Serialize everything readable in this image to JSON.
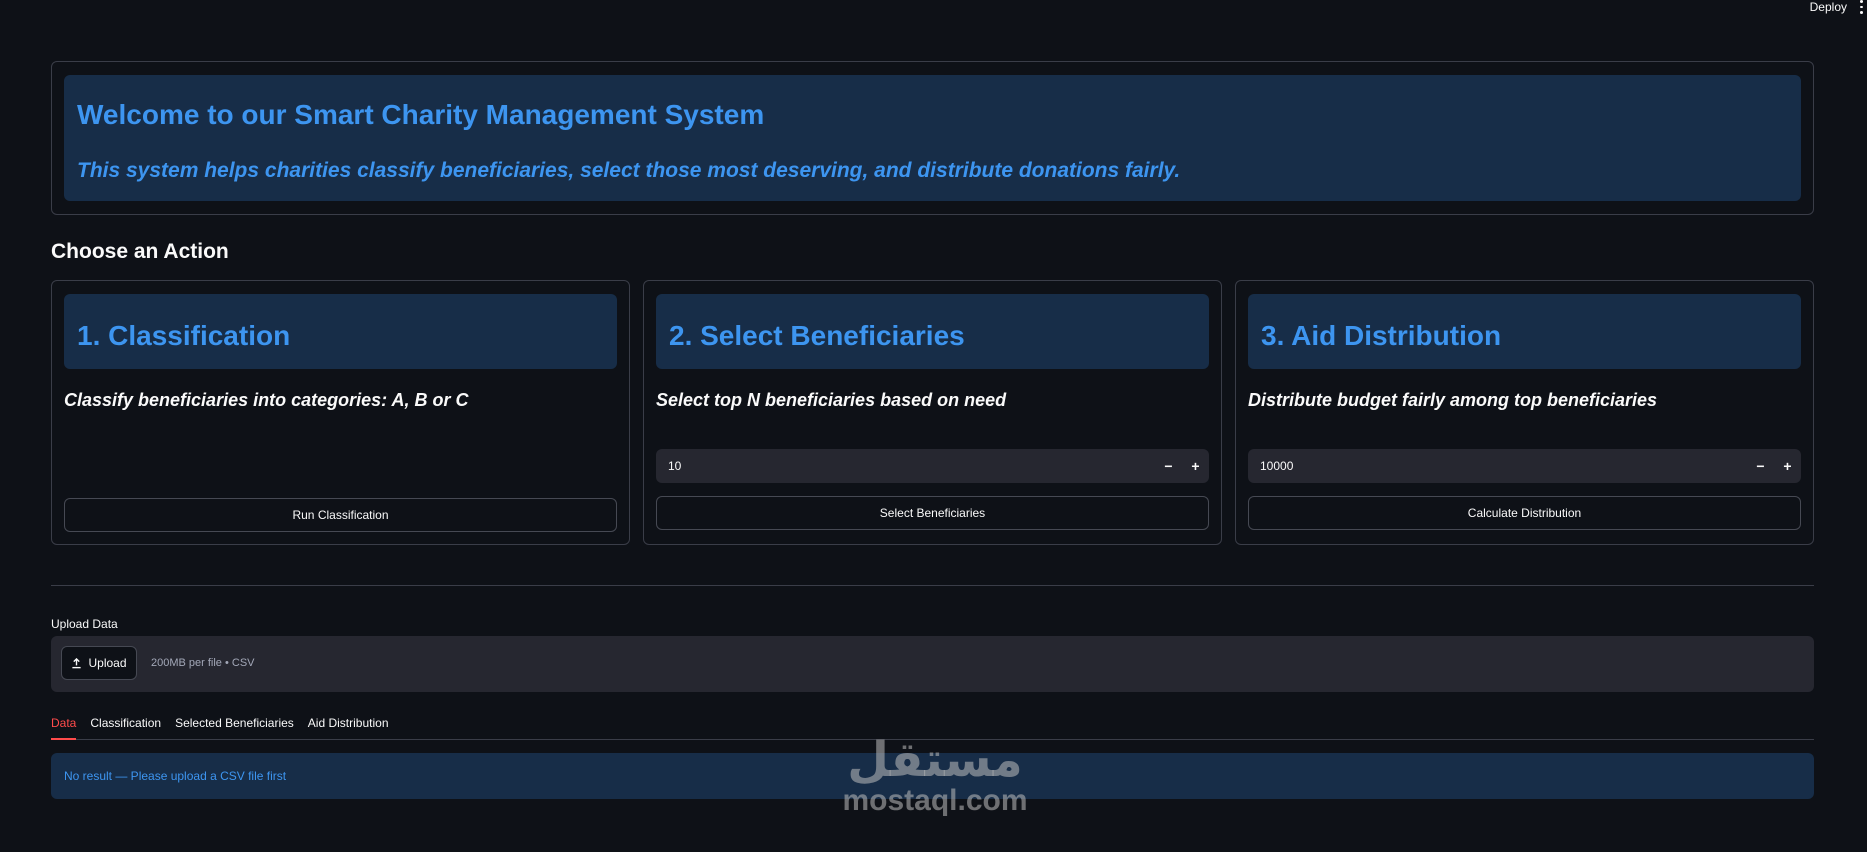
{
  "topbar": {
    "deploy_label": "Deploy"
  },
  "welcome": {
    "title": "Welcome to our Smart Charity Management System",
    "subtitle": "This system helps charities classify beneficiaries, select those most deserving, and distribute donations fairly."
  },
  "actions": {
    "section_title": "Choose an Action",
    "classification": {
      "title": "1. Classification",
      "description": "Classify beneficiaries into categories: A, B or C",
      "button_label": "Run Classification"
    },
    "select": {
      "title": "2. Select Beneficiaries",
      "description": "Select top N beneficiaries based on need",
      "input_value": "10",
      "button_label": "Select Beneficiaries"
    },
    "distribution": {
      "title": "3. Aid Distribution",
      "description": "Distribute budget fairly among top beneficiaries",
      "input_value": "10000",
      "button_label": "Calculate Distribution"
    },
    "stepper_minus": "−",
    "stepper_plus": "+"
  },
  "upload": {
    "label": "Upload Data",
    "button_label": "Upload",
    "upload_icon": "upload-icon",
    "hint": "200MB per file • CSV"
  },
  "tabs": [
    {
      "label": "Data",
      "active": true
    },
    {
      "label": "Classification",
      "active": false
    },
    {
      "label": "Selected Beneficiaries",
      "active": false
    },
    {
      "label": "Aid Distribution",
      "active": false
    }
  ],
  "info": {
    "message": "No result — Please upload a CSV file first"
  },
  "watermark": {
    "arabic": "مستقل",
    "latin": "mostaql.com"
  },
  "colors": {
    "background": "#0e1117",
    "accent_blue": "#3d95f0",
    "info_bg": "#172d48",
    "active_tab": "#ff4b4b"
  }
}
